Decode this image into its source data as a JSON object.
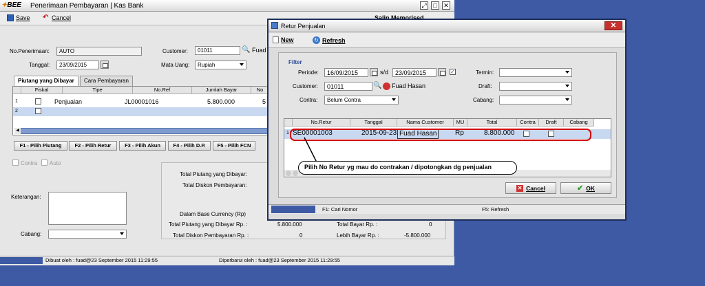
{
  "main": {
    "logo": "BEE",
    "title": "Penerimaan Pembayaran | Kas Bank",
    "toolbar": {
      "save": "Save",
      "cancel": "Cancel",
      "right_label": "Salin Memorised"
    },
    "form": {
      "no_penerimaan_label": "No.Penerimaan:",
      "no_penerimaan": "AUTO",
      "tanggal_label": "Tanggal:",
      "tanggal": "23/09/2015",
      "customer_label": "Customer:",
      "customer_code": "01011",
      "customer_name": "Fuad",
      "mata_uang_label": "Mata Uang:",
      "mata_uang": "Rupiah"
    },
    "tabs": [
      "Piutang yang Dibayar",
      "Cara Pembayaran"
    ],
    "grid": {
      "headers": [
        "Fiskal",
        "Tipe",
        "No.Ref",
        "Jumlah Bayar",
        "No"
      ],
      "rows": [
        {
          "num": "1",
          "tipe": "Penjualan",
          "noref": "JL00001016",
          "jumlah": "5.800.000",
          "no": "5"
        },
        {
          "num": "2",
          "tipe": "",
          "noref": "",
          "jumlah": "",
          "no": ""
        }
      ]
    },
    "fbuttons": [
      "F1 - Pilih Piutang",
      "F2 - Pilih Retur",
      "F3 - Pilih Akun",
      "F4 - Pilih D.P.",
      "F5 - Pilih FCN"
    ],
    "contra_label": "Contra",
    "auto_label": "Auto",
    "keterangan_label": "Keterangan:",
    "cabang_label": "Cabang:",
    "summary": {
      "total_piutang_label": "Total Piutang yang Dibayar:",
      "total_diskon_label": "Total Diskon Pembayaran:",
      "base_currency_label": "Dalam Base Currency (Rp)",
      "total_piutang_rp_label": "Total Piutang yang Dibayar Rp. :",
      "total_piutang_rp": "5.800.000",
      "total_diskon_rp_label": "Total Diskon Pembayaran Rp. :",
      "total_diskon_rp": "0",
      "total_bayar_label": "Total Bayar Rp. :",
      "total_bayar": "0",
      "lebih_bayar_label": "Lebih Bayar Rp. :",
      "lebih_bayar": "-5.800.000"
    },
    "status": {
      "dibuat": "Dibuat oleh :  fuad@23 September 2015  11:29:55",
      "diperbarui": "Diperbarui oleh :  fuad@23 September 2015  11:29:55"
    }
  },
  "dialog": {
    "title": "Retur Penjualan",
    "toolbar": {
      "new": "New",
      "refresh": "Refresh"
    },
    "filter": {
      "title": "Filter",
      "periode_label": "Periode:",
      "periode_from": "16/09/2015",
      "sd": "s/d",
      "periode_to": "23/09/2015",
      "customer_label": "Customer:",
      "customer_code": "01011",
      "customer_name": "Fuad Hasan",
      "contra_label": "Contra:",
      "contra": "Belum Contra",
      "termin_label": "Termin:",
      "draft_label": "Draft:",
      "cabang_label": "Cabang:"
    },
    "grid": {
      "headers": [
        "No.Retur",
        "Tanggal",
        "Nama Customer",
        "MU",
        "Total",
        "Contra",
        "Draft",
        "Cabang"
      ],
      "rows": [
        {
          "num": "1",
          "noretur": "SE00001003",
          "tanggal": "2015-09-23",
          "customer": "Fuad Hasan",
          "mu": "Rp",
          "total": "8.800.000"
        }
      ]
    },
    "annotation": "Pilih No Retur yg mau do contrakan / dipotongkan dg penjualan",
    "buttons": {
      "cancel": "Cancel",
      "ok": "OK"
    },
    "status": {
      "f1": "F1: Cari Nomor",
      "f5": "F5: Refresh"
    }
  },
  "colors": {
    "desktop": "#3e5aa4",
    "highlight": "#c8d8f0",
    "annotation_red": "#d40000"
  }
}
